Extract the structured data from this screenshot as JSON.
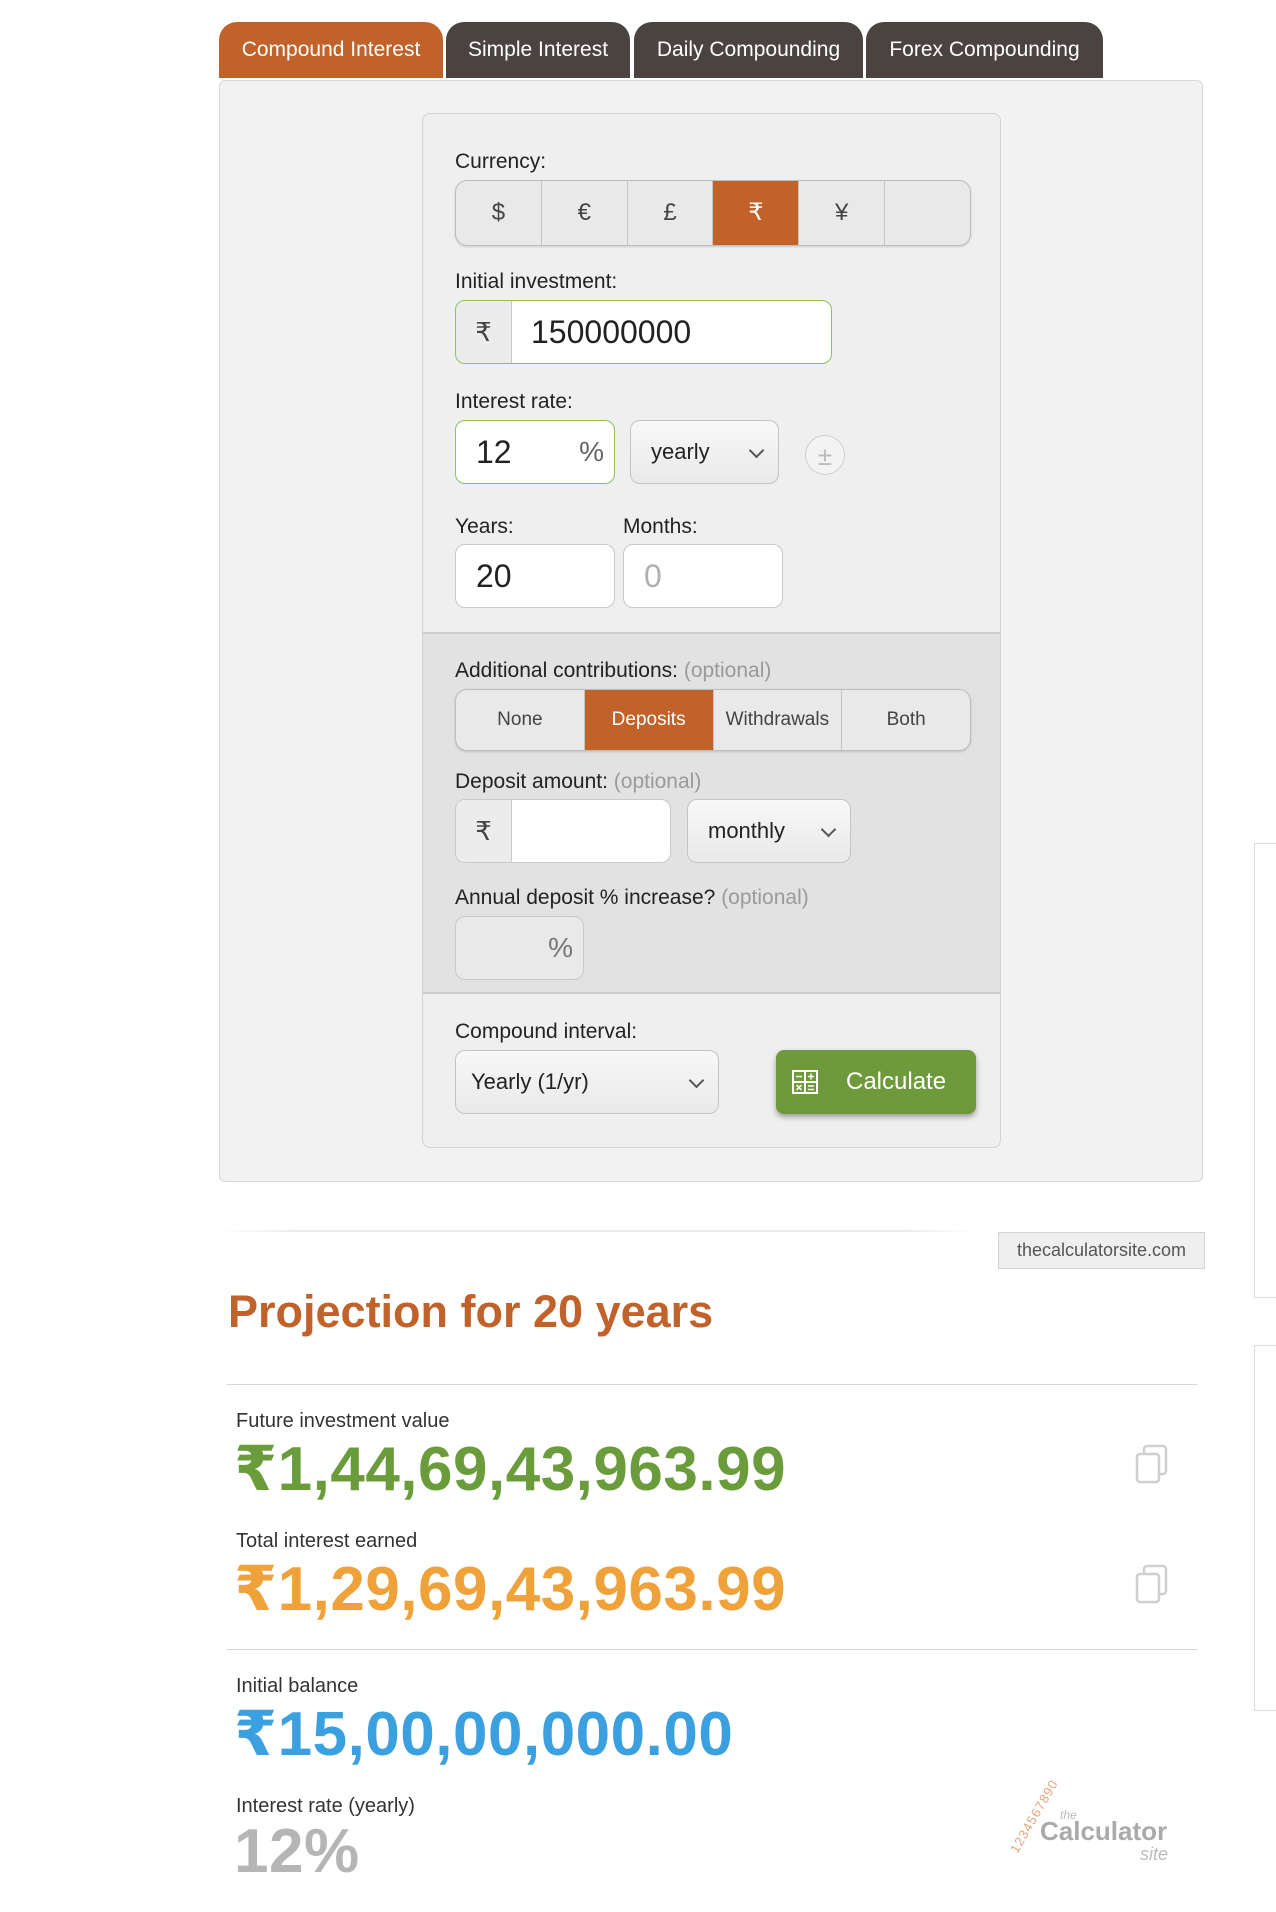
{
  "tabs": [
    {
      "label": "Compound Interest",
      "active": true
    },
    {
      "label": "Simple Interest",
      "active": false
    },
    {
      "label": "Daily Compounding",
      "active": false
    },
    {
      "label": "Forex Compounding",
      "active": false
    }
  ],
  "calculator": {
    "currency_label": "Currency:",
    "currencies": [
      "$",
      "€",
      "£",
      "₹",
      "¥",
      ""
    ],
    "selected_currency": "₹",
    "initial_investment_label": "Initial investment:",
    "initial_investment_symbol": "₹",
    "initial_investment_value": "150000000",
    "interest_rate_label": "Interest rate:",
    "interest_rate_value": "12",
    "percent_symbol": "%",
    "rate_period": "yearly",
    "add_rate_symbol": "±",
    "years_label": "Years:",
    "years_value": "20",
    "months_label": "Months:",
    "months_placeholder": "0",
    "contributions_label": "Additional contributions:",
    "optional_text": "(optional)",
    "contribution_options": [
      "None",
      "Deposits",
      "Withdrawals",
      "Both"
    ],
    "selected_contribution": "Deposits",
    "deposit_amount_label": "Deposit amount:",
    "deposit_symbol": "₹",
    "deposit_value": "",
    "deposit_frequency": "monthly",
    "annual_increase_label": "Annual deposit % increase?",
    "annual_increase_value": "",
    "compound_interval_label": "Compound interval:",
    "compound_interval_value": "Yearly (1/yr)",
    "calculate_label": "Calculate"
  },
  "results": {
    "site_badge": "thecalculatorsite.com",
    "heading": "Projection for 20 years",
    "future_value_label": "Future investment value",
    "future_value": "₹1,44,69,43,963.99",
    "interest_earned_label": "Total interest earned",
    "interest_earned": "₹1,29,69,43,963.99",
    "initial_balance_label": "Initial balance",
    "initial_balance": "₹15,00,00,000.00",
    "rate_label": "Interest rate (yearly)",
    "rate_value": "12%",
    "logo": {
      "digits": "1234567890",
      "the": "the",
      "name": "Calculator",
      "site": "site"
    }
  },
  "colors": {
    "accent": "#c0622a",
    "tab_dark": "#4a433f",
    "calculate_green": "#6e9a3c",
    "future_value": "#6a9c3c",
    "interest_earned": "#f0a23a",
    "initial_balance": "#3ba0e0",
    "rate": "#b5b5b5"
  }
}
